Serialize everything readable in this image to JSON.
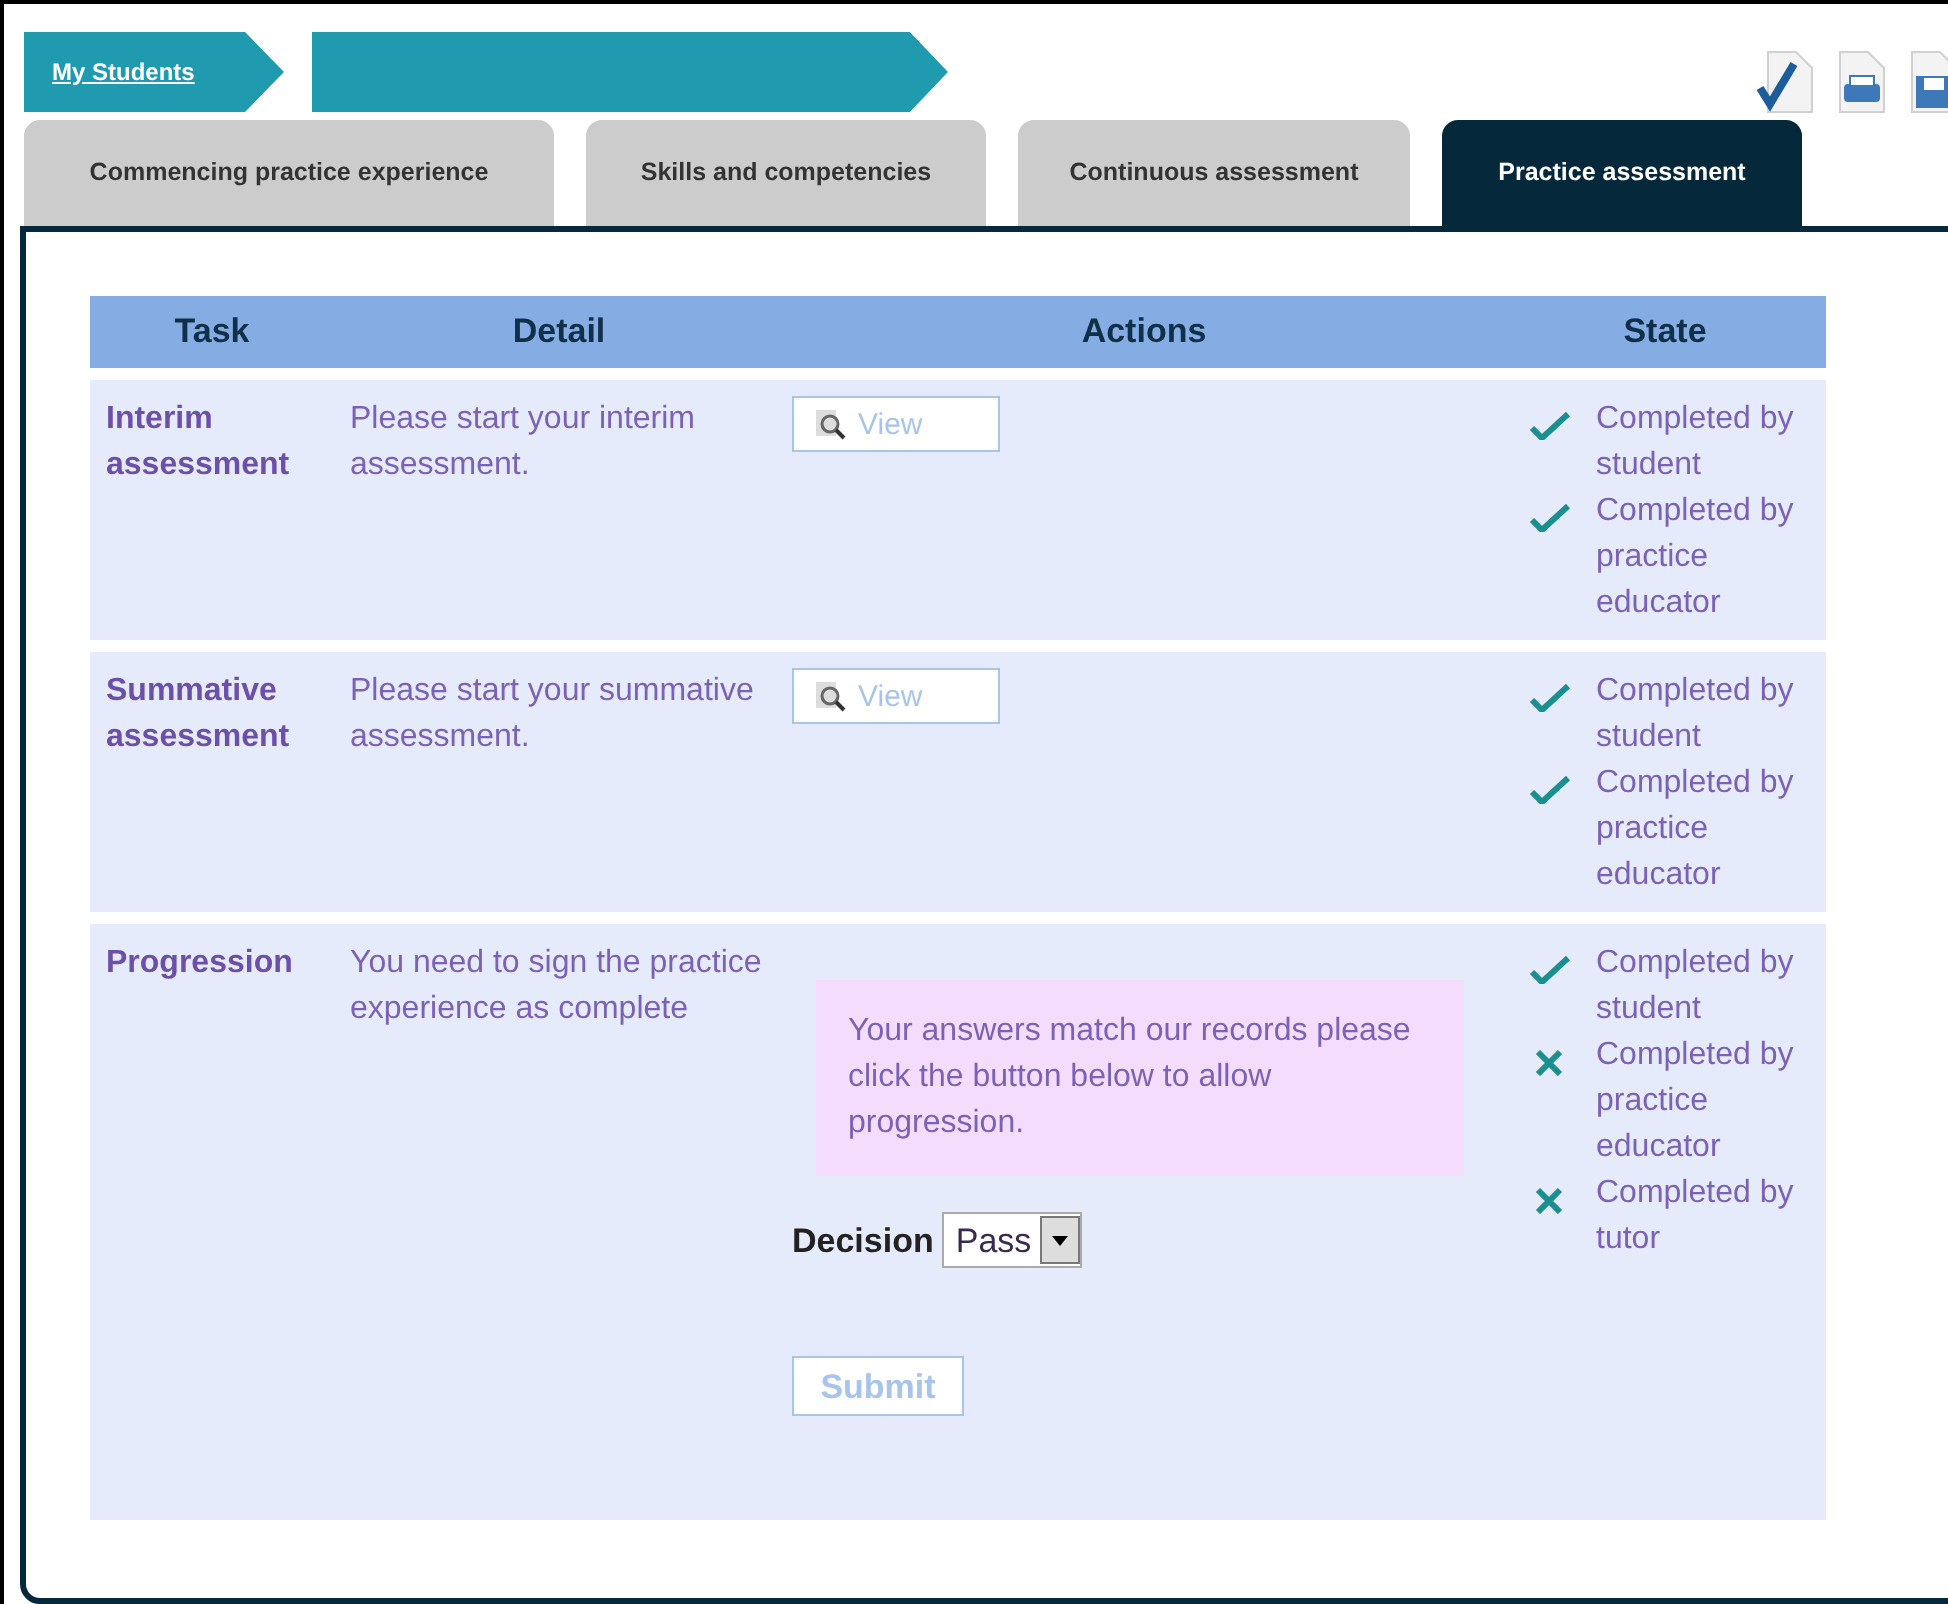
{
  "breadcrumb": {
    "link": "My Students"
  },
  "tabs": [
    {
      "label": "Commencing practice experience",
      "selected": false
    },
    {
      "label": "Skills and competencies",
      "selected": false
    },
    {
      "label": "Continuous assessment",
      "selected": false
    },
    {
      "label": "Practice assessment",
      "selected": true
    }
  ],
  "table": {
    "columns": [
      "Task",
      "Detail",
      "Actions",
      "State"
    ],
    "rows": [
      {
        "task": "Interim assessment",
        "detail": "Please start your interim assessment.",
        "action": {
          "kind": "view",
          "label": "View"
        },
        "states": [
          {
            "text": "Completed by student",
            "done": true
          },
          {
            "text": "Completed by practice educator",
            "done": true
          }
        ]
      },
      {
        "task": "Summative assessment",
        "detail": "Please start your summative assessment.",
        "action": {
          "kind": "view",
          "label": "View"
        },
        "states": [
          {
            "text": "Completed by student",
            "done": true
          },
          {
            "text": "Completed by practice educator",
            "done": true
          }
        ]
      },
      {
        "task": "Progression",
        "detail": "You need to sign the practice experience as complete",
        "action": {
          "kind": "progression",
          "message": "Your answers match our records please click the button below to allow progression.",
          "decision_label": "Decision",
          "decision_value": "Pass",
          "submit": "Submit"
        },
        "states": [
          {
            "text": "Completed by student",
            "done": true
          },
          {
            "text": "Completed by practice educator",
            "done": false
          },
          {
            "text": "Completed by tutor",
            "done": false
          }
        ]
      }
    ]
  }
}
